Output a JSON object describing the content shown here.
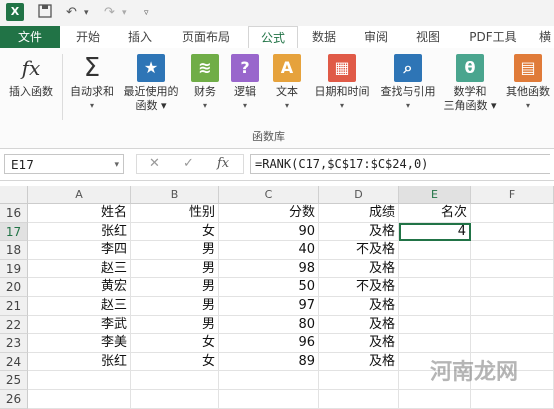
{
  "app": {
    "logo": "X",
    "undo_icon": "undo-icon",
    "redo_icon": "redo-icon"
  },
  "tabs": [
    "文件",
    "开始",
    "插入",
    "页面布局",
    "公式",
    "数据",
    "审阅",
    "视图",
    "PDF工具",
    "横"
  ],
  "ribbon": {
    "buttons": [
      {
        "label1": "插入函数",
        "label2": "",
        "icon": "fx-icon",
        "color": "#ffffff"
      },
      {
        "label1": "自动求和",
        "label2": "▾",
        "icon": "sigma-icon",
        "color": "#ffffff"
      },
      {
        "label1": "最近使用的",
        "label2": "函数 ▾",
        "icon": "star-icon",
        "color": "#2e75b6"
      },
      {
        "label1": "财务",
        "label2": "▾",
        "icon": "coins-icon",
        "color": "#70ad47"
      },
      {
        "label1": "逻辑",
        "label2": "▾",
        "icon": "question-icon",
        "color": "#9966cc"
      },
      {
        "label1": "文本",
        "label2": "▾",
        "icon": "text-a-icon",
        "color": "#e6a23c"
      },
      {
        "label1": "日期和时间",
        "label2": "▾",
        "icon": "calendar-icon",
        "color": "#e05a47"
      },
      {
        "label1": "查找与引用",
        "label2": "▾",
        "icon": "search-icon",
        "color": "#2e75b6"
      },
      {
        "label1": "数学和",
        "label2": "三角函数 ▾",
        "icon": "theta-icon",
        "color": "#4aa58e"
      },
      {
        "label1": "其他函数",
        "label2": "▾",
        "icon": "more-functions-icon",
        "color": "#e07b39"
      }
    ],
    "group_label": "函数库"
  },
  "formula_bar": {
    "name_box": "E17",
    "fx": "fx",
    "formula": "=RANK(C17,$C$17:$C$24,0)"
  },
  "columns": [
    "A",
    "B",
    "C",
    "D",
    "E",
    "F"
  ],
  "rows": [
    {
      "num": "16",
      "a": "姓名",
      "b": "性别",
      "c": "分数",
      "d": "成绩",
      "e": "名次"
    },
    {
      "num": "17",
      "a": "张红",
      "b": "女",
      "c": "90",
      "d": "及格",
      "e": "4"
    },
    {
      "num": "18",
      "a": "李四",
      "b": "男",
      "c": "40",
      "d": "不及格",
      "e": ""
    },
    {
      "num": "19",
      "a": "赵三",
      "b": "男",
      "c": "98",
      "d": "及格",
      "e": ""
    },
    {
      "num": "20",
      "a": "黄宏",
      "b": "男",
      "c": "50",
      "d": "不及格",
      "e": ""
    },
    {
      "num": "21",
      "a": "赵三",
      "b": "男",
      "c": "97",
      "d": "及格",
      "e": ""
    },
    {
      "num": "22",
      "a": "李武",
      "b": "男",
      "c": "80",
      "d": "及格",
      "e": ""
    },
    {
      "num": "23",
      "a": "李美",
      "b": "女",
      "c": "96",
      "d": "及格",
      "e": ""
    },
    {
      "num": "24",
      "a": "张红",
      "b": "女",
      "c": "89",
      "d": "及格",
      "e": ""
    },
    {
      "num": "25",
      "a": "",
      "b": "",
      "c": "",
      "d": "",
      "e": ""
    },
    {
      "num": "26",
      "a": "",
      "b": "",
      "c": "",
      "d": "",
      "e": ""
    }
  ],
  "watermark": "河南龙网"
}
